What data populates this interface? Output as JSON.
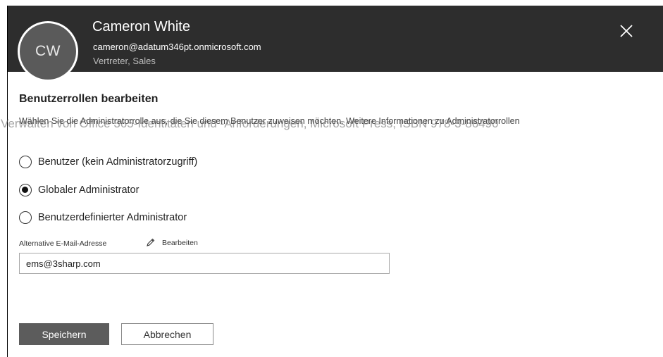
{
  "header": {
    "avatar_initials": "CW",
    "user_name": "Cameron White",
    "user_email": "cameron@adatum346pt.onmicrosoft.com",
    "user_role": "Vertreter, Sales",
    "close_icon": "close-icon"
  },
  "panel": {
    "title": "Benutzerrollen bearbeiten",
    "description": "Wählen Sie die Administratorrolle aus, die Sie diesem Benutzer zuweisen möchten. Weitere Informationen zu Administratorrollen",
    "watermark": "Verwalten von Office 365-Identitäten und -Anforderungen, Microsoft Press, ISBN 978-3-86490",
    "roles": [
      {
        "label": "Benutzer (kein Administratorzugriff)",
        "checked": false
      },
      {
        "label": "Globaler Administrator",
        "checked": true
      },
      {
        "label": "Benutzerdefinierter Administrator",
        "checked": false
      }
    ],
    "alt_email_label": "Alternative E-Mail-Adresse",
    "edit_label": "Bearbeiten",
    "alt_email_value": "ems@3sharp.com"
  },
  "buttons": {
    "save_label": "Speichern",
    "cancel_label": "Abbrechen"
  },
  "colors": {
    "header_bg": "#2d2d2d",
    "save_bg": "#5c5c5c"
  }
}
